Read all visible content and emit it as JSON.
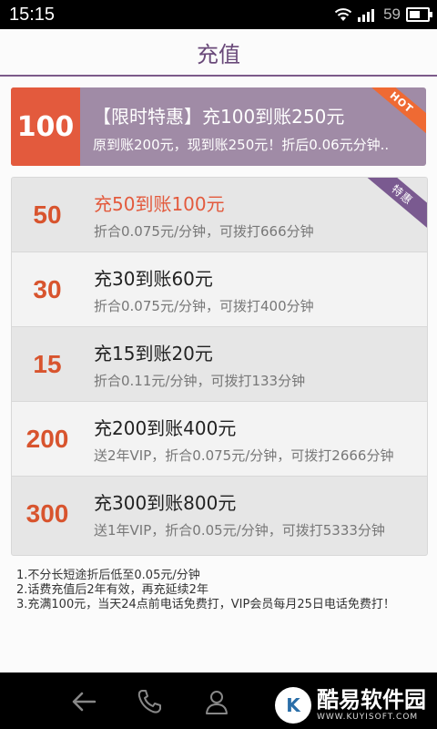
{
  "status_bar": {
    "time": "15:15",
    "battery": "59",
    "battery_level": 0.59
  },
  "header": {
    "title": "充值"
  },
  "promo": {
    "amount": "100",
    "title": "【限时特惠】充100到账250元",
    "subtitle": "原到账200元，现到账250元！折后0.06元分钟..",
    "badge": "HOT"
  },
  "packages": [
    {
      "amount": "50",
      "title": "充50到账100元",
      "desc": "折合0.075元/分钟，可拨打666分钟",
      "badge": "特惠",
      "highlight": true
    },
    {
      "amount": "30",
      "title": "充30到账60元",
      "desc": "折合0.075元/分钟，可拨打400分钟"
    },
    {
      "amount": "15",
      "title": "充15到账20元",
      "desc": "折合0.11元/分钟，可拨打133分钟"
    },
    {
      "amount": "200",
      "title": "充200到账400元",
      "desc": "送2年VIP，折合0.075元/分钟，可拨打2666分钟"
    },
    {
      "amount": "300",
      "title": "充300到账800元",
      "desc": "送1年VIP，折合0.05元/分钟，可拨打5333分钟"
    }
  ],
  "notes": [
    "1.不分长短途折后低至0.05元/分钟",
    "2.话费充值后2年有效，再充延续2年",
    "3.充满100元，当天24点前电话免费打，VIP会员每月25日电话免费打！"
  ],
  "watermark": {
    "logo_letter": "K",
    "text": "酷易软件园",
    "url": "WWW.KUYISOFT.COM"
  },
  "colors": {
    "accent": "#e35a3d",
    "purple": "#7c5a8a",
    "promo_bg": "#a08ba6"
  }
}
